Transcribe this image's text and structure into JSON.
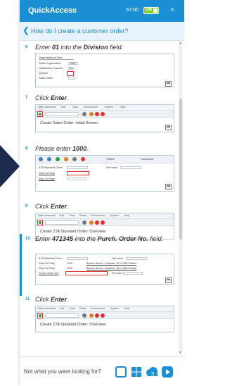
{
  "header": {
    "title": "QuickAccess",
    "sync_label": "SYNC",
    "sync_state": "ON",
    "close": "×"
  },
  "question": "How do I create a customer order?",
  "steps": [
    {
      "number": "6",
      "text_before": "Enter ",
      "text_bold": "01",
      "text_after": " into the ",
      "text_bold2": "Division",
      "text_end": " field.",
      "screenshot": {
        "group_label": "Organizational Data",
        "fields": [
          "Sales Organization",
          "Distribution Channel",
          "Division",
          "Sales Office"
        ],
        "values": [
          "0001",
          "01",
          "",
          ""
        ]
      }
    },
    {
      "number": "7",
      "text_before": "Click ",
      "text_bold": "Enter",
      "text_end": ".",
      "screenshot": {
        "menu": [
          "Sales document",
          "Edit",
          "Goto",
          "Environment",
          "System",
          "Help"
        ],
        "title": "Create Sales Order: Initial Screen"
      }
    },
    {
      "number": "8",
      "text_before": "Please enter ",
      "text_bold": "1000",
      "text_end": ".",
      "screenshot": {
        "toolbar": [
          "Orders",
          "Document"
        ],
        "fields": [
          "ZTA Standard Order",
          "Sold-To Party",
          "Ship-To Party"
        ],
        "net_value": "Net value"
      }
    },
    {
      "number": "9",
      "text_before": "Click ",
      "text_bold": "Enter",
      "text_end": ".",
      "screenshot": {
        "menu": [
          "Sales document",
          "Edit",
          "Goto",
          "Extras",
          "Environment",
          "System",
          "Help"
        ],
        "title": "Create ZTA Standard Order: Overview"
      }
    },
    {
      "number": "10",
      "text_before": "Enter ",
      "text_bold": "471345",
      "text_after": " into the ",
      "text_bold2": "Purch. Order No.",
      "text_end": " field.",
      "screenshot": {
        "fields": [
          "ZTA Standard Order",
          "Sold-To Party",
          "Ship-To Party",
          "Purch. Order No."
        ],
        "codes": [
          "",
          "1000",
          "1000",
          ""
        ],
        "parties": [
          "",
          "Becker Berlin / Calvinstr. 36 / 13467 Berlin",
          "Becker Berlin / Calvinstr. 36 / 13467 Berlin",
          ""
        ],
        "net_value": "Net value",
        "po_date": "PO Date"
      }
    },
    {
      "number": "11",
      "text_before": "Click ",
      "text_bold": "Enter",
      "text_end": ".",
      "screenshot": {
        "menu": [
          "Sales document",
          "Edit",
          "Goto",
          "Extras",
          "Environment",
          "System",
          "Help"
        ],
        "title": "Create ZTA Standard Order: Overview"
      }
    }
  ],
  "footer": {
    "text": "Not what you were looking for?",
    "icons": [
      "chat-icon",
      "windows-icon",
      "sap-cloud-icon",
      "video-icon"
    ]
  },
  "colors": {
    "accent": "#1b8fd3",
    "sync_on": "#7ed321",
    "highlight": "#e03030"
  }
}
